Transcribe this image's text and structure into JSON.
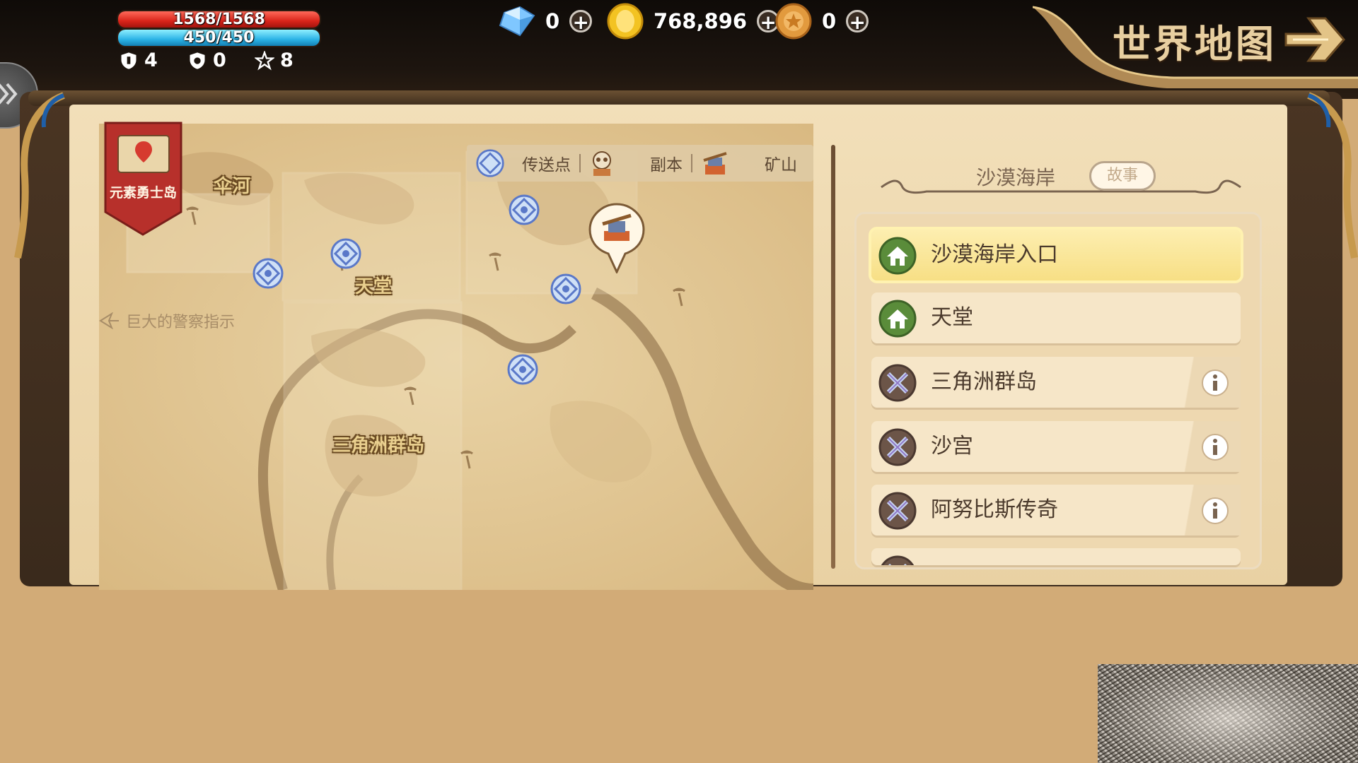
{
  "hud": {
    "hp_text": "1568/1568",
    "hp_fraction": 1.0,
    "mp_text": "450/450",
    "mp_fraction": 1.0,
    "stat_shield": "4",
    "stat_shield2": "0",
    "stat_star": "8"
  },
  "currency": {
    "gems": "0",
    "gold": "768,896",
    "tokens": "0",
    "plus": "+"
  },
  "title": "世界地图",
  "map": {
    "ribbon_label": "元素勇士岛",
    "labels": [
      "伞河",
      "天堂",
      "三角洲群岛"
    ],
    "legend": {
      "waypoint": "传送点",
      "dungeon": "副本",
      "mine": "矿山"
    },
    "hint": "巨大的警察指示"
  },
  "panel": {
    "region_name": "沙漠海岸",
    "story_badge": "故事",
    "items": [
      {
        "label": "沙漠海岸入口",
        "icon": "town-icon",
        "selected": true,
        "info": false
      },
      {
        "label": "天堂",
        "icon": "town-icon",
        "selected": false,
        "info": false
      },
      {
        "label": "三角洲群岛",
        "icon": "crossed-swords-icon",
        "selected": false,
        "info": true
      },
      {
        "label": "沙宫",
        "icon": "crossed-swords-icon",
        "selected": false,
        "info": true
      },
      {
        "label": "阿努比斯传奇",
        "icon": "crossed-swords-icon",
        "selected": false,
        "info": true
      },
      {
        "label": "",
        "icon": "crossed-swords-icon",
        "selected": false,
        "info": true
      }
    ]
  },
  "colors": {
    "accent_gold": "#e8cfa0",
    "selected_row": "#f7df85",
    "parchment": "#f2dfb9",
    "background": "#d2ab77"
  }
}
